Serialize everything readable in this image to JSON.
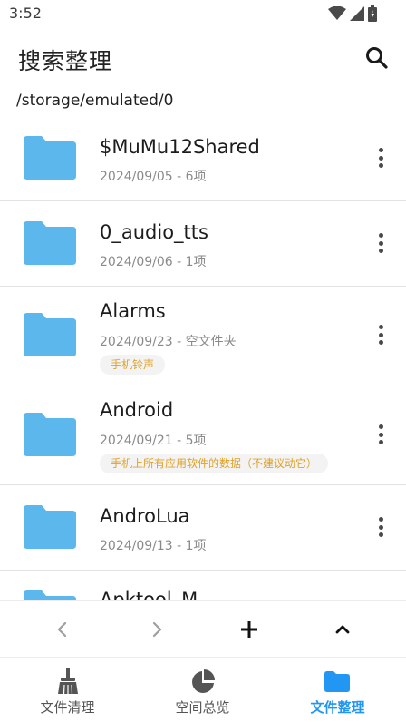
{
  "status_bar": {
    "time": "3:52"
  },
  "app_bar": {
    "title": "搜索整理"
  },
  "path": "/storage/emulated/0",
  "files": [
    {
      "name": "$MuMu12Shared",
      "meta": "2024/09/05 - 6项",
      "tag": ""
    },
    {
      "name": "0_audio_tts",
      "meta": "2024/09/06 - 1项",
      "tag": ""
    },
    {
      "name": "Alarms",
      "meta": "2024/09/23 - 空文件夹",
      "tag": "手机铃声"
    },
    {
      "name": "Android",
      "meta": "2024/09/21 - 5项",
      "tag": "手机上所有应用软件的数据（不建议动它）"
    },
    {
      "name": "AndroLua",
      "meta": "2024/09/13 - 1项",
      "tag": ""
    },
    {
      "name": "Apktool_M",
      "meta": "",
      "tag": ""
    }
  ],
  "bottom_nav": {
    "items": [
      {
        "label": "文件清理",
        "icon": "broom-icon",
        "active": false
      },
      {
        "label": "空间总览",
        "icon": "pie-chart-icon",
        "active": false
      },
      {
        "label": "文件整理",
        "icon": "folder-icon",
        "active": true
      }
    ]
  },
  "colors": {
    "folder": "#5bb7ec",
    "accent": "#2196f3",
    "tag_text": "#e0a22a"
  }
}
